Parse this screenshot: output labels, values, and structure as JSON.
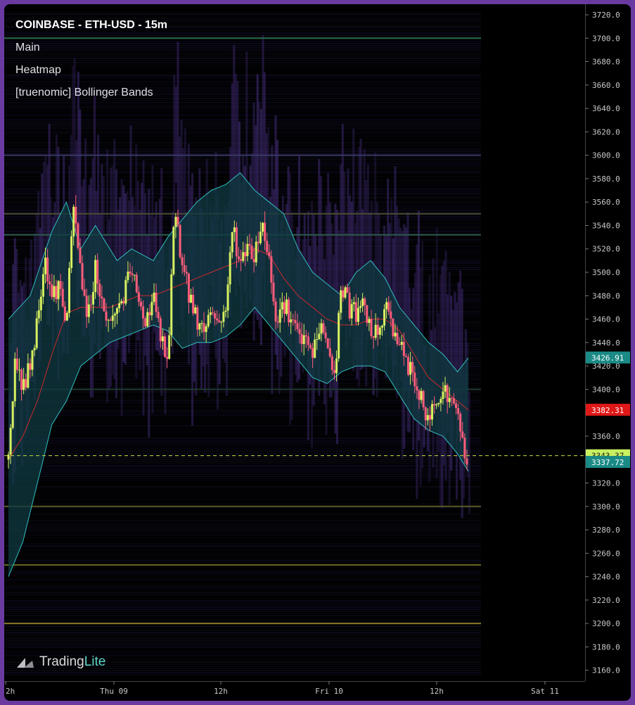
{
  "legend": {
    "title": "COINBASE - ETH-USD - 15m",
    "lines": [
      "Main",
      "Heatmap",
      "[truenomic] Bollinger Bands"
    ]
  },
  "brand": {
    "part1": "Trading",
    "part2": "Lite"
  },
  "colors": {
    "up": "#d8f060",
    "down": "#ff5c7a",
    "band_fill": "#0f3a40",
    "band_edge": "#2fbfbf",
    "basis": "#cc2a2a",
    "last_line": "#c8e040",
    "background": "#000000",
    "axis_text": "#c8c8cc"
  },
  "chart_data": {
    "type": "candlestick",
    "y_axis": {
      "range": [
        3155,
        3723
      ],
      "ticks": [
        "3720.0",
        "3700.0",
        "3680.0",
        "3660.0",
        "3640.0",
        "3620.0",
        "3600.0",
        "3580.0",
        "3560.0",
        "3540.0",
        "3520.0",
        "3500.0",
        "3480.0",
        "3460.0",
        "3440.0",
        "3420.0",
        "3400.0",
        "3380.0",
        "3360.0",
        "3340.0",
        "3320.0",
        "3300.0",
        "3280.0",
        "3260.0",
        "3240.0",
        "3220.0",
        "3200.0",
        "3180.0",
        "3160.0"
      ]
    },
    "x_axis": {
      "range_hours": [
        0,
        95
      ],
      "ticks": [
        {
          "label": "2h",
          "hour": 0
        },
        {
          "label": "Thu 09",
          "hour": 22
        },
        {
          "label": "12h",
          "hour": 34
        },
        {
          "label": "Fri 10",
          "hour": 46
        },
        {
          "label": "12h",
          "hour": 58
        },
        {
          "label": "Sat 11",
          "hour": 70
        }
      ]
    },
    "price_series": [
      [
        0,
        3340
      ],
      [
        2,
        3430
      ],
      [
        4,
        3400
      ],
      [
        6,
        3420
      ],
      [
        8,
        3460
      ],
      [
        10,
        3515
      ],
      [
        12,
        3480
      ],
      [
        14,
        3490
      ],
      [
        16,
        3455
      ],
      [
        18,
        3555
      ],
      [
        20,
        3500
      ],
      [
        22,
        3460
      ],
      [
        24,
        3505
      ],
      [
        26,
        3470
      ],
      [
        28,
        3455
      ],
      [
        30,
        3470
      ],
      [
        32,
        3480
      ],
      [
        34,
        3505
      ],
      [
        36,
        3470
      ],
      [
        38,
        3460
      ],
      [
        40,
        3480
      ],
      [
        42,
        3445
      ],
      [
        44,
        3420
      ],
      [
        46,
        3560
      ],
      [
        48,
        3505
      ],
      [
        50,
        3480
      ],
      [
        52,
        3460
      ],
      [
        54,
        3450
      ],
      [
        56,
        3470
      ],
      [
        58,
        3455
      ],
      [
        60,
        3470
      ],
      [
        62,
        3540
      ],
      [
        64,
        3505
      ],
      [
        66,
        3525
      ],
      [
        68,
        3515
      ],
      [
        70,
        3545
      ],
      [
        72,
        3510
      ],
      [
        74,
        3460
      ],
      [
        76,
        3475
      ],
      [
        78,
        3460
      ],
      [
        80,
        3445
      ],
      [
        82,
        3440
      ],
      [
        84,
        3430
      ],
      [
        86,
        3455
      ],
      [
        88,
        3440
      ],
      [
        90,
        3410
      ],
      [
        92,
        3490
      ],
      [
        94,
        3470
      ],
      [
        96,
        3465
      ],
      [
        98,
        3470
      ],
      [
        100,
        3450
      ],
      [
        102,
        3445
      ],
      [
        104,
        3470
      ],
      [
        106,
        3455
      ],
      [
        108,
        3440
      ],
      [
        110,
        3420
      ],
      [
        112,
        3410
      ],
      [
        114,
        3390
      ],
      [
        116,
        3370
      ],
      [
        118,
        3395
      ],
      [
        120,
        3400
      ],
      [
        122,
        3390
      ],
      [
        124,
        3380
      ],
      [
        126,
        3345
      ],
      [
        127,
        3337.72
      ]
    ],
    "bollinger": {
      "upper": [
        [
          0,
          3460
        ],
        [
          6,
          3480
        ],
        [
          12,
          3535
        ],
        [
          16,
          3560
        ],
        [
          20,
          3520
        ],
        [
          24,
          3540
        ],
        [
          30,
          3510
        ],
        [
          34,
          3520
        ],
        [
          40,
          3510
        ],
        [
          44,
          3530
        ],
        [
          48,
          3545
        ],
        [
          52,
          3560
        ],
        [
          56,
          3570
        ],
        [
          60,
          3575
        ],
        [
          64,
          3585
        ],
        [
          68,
          3570
        ],
        [
          72,
          3560
        ],
        [
          76,
          3550
        ],
        [
          80,
          3520
        ],
        [
          84,
          3500
        ],
        [
          88,
          3490
        ],
        [
          92,
          3480
        ],
        [
          96,
          3500
        ],
        [
          100,
          3510
        ],
        [
          104,
          3495
        ],
        [
          108,
          3470
        ],
        [
          112,
          3455
        ],
        [
          116,
          3440
        ],
        [
          120,
          3430
        ],
        [
          124,
          3415
        ],
        [
          127,
          3426.91
        ]
      ],
      "basis": [
        [
          0,
          3340
        ],
        [
          4,
          3360
        ],
        [
          8,
          3390
        ],
        [
          12,
          3430
        ],
        [
          16,
          3465
        ],
        [
          20,
          3470
        ],
        [
          24,
          3470
        ],
        [
          28,
          3470
        ],
        [
          32,
          3475
        ],
        [
          36,
          3480
        ],
        [
          40,
          3480
        ],
        [
          44,
          3485
        ],
        [
          48,
          3490
        ],
        [
          52,
          3495
        ],
        [
          56,
          3500
        ],
        [
          60,
          3505
        ],
        [
          64,
          3510
        ],
        [
          68,
          3520
        ],
        [
          72,
          3515
        ],
        [
          76,
          3495
        ],
        [
          80,
          3480
        ],
        [
          84,
          3470
        ],
        [
          88,
          3460
        ],
        [
          92,
          3455
        ],
        [
          96,
          3455
        ],
        [
          100,
          3460
        ],
        [
          104,
          3460
        ],
        [
          108,
          3450
        ],
        [
          112,
          3430
        ],
        [
          116,
          3410
        ],
        [
          120,
          3400
        ],
        [
          124,
          3390
        ],
        [
          127,
          3382.31
        ]
      ],
      "lower": [
        [
          0,
          3240
        ],
        [
          4,
          3270
        ],
        [
          8,
          3320
        ],
        [
          12,
          3370
        ],
        [
          16,
          3390
        ],
        [
          20,
          3420
        ],
        [
          24,
          3430
        ],
        [
          28,
          3440
        ],
        [
          32,
          3445
        ],
        [
          36,
          3450
        ],
        [
          40,
          3455
        ],
        [
          44,
          3450
        ],
        [
          48,
          3435
        ],
        [
          52,
          3440
        ],
        [
          56,
          3440
        ],
        [
          60,
          3445
        ],
        [
          64,
          3455
        ],
        [
          68,
          3470
        ],
        [
          72,
          3455
        ],
        [
          76,
          3440
        ],
        [
          80,
          3425
        ],
        [
          84,
          3410
        ],
        [
          88,
          3405
        ],
        [
          92,
          3415
        ],
        [
          96,
          3420
        ],
        [
          100,
          3420
        ],
        [
          104,
          3415
        ],
        [
          108,
          3395
        ],
        [
          112,
          3375
        ],
        [
          116,
          3365
        ],
        [
          120,
          3360
        ],
        [
          124,
          3345
        ],
        [
          127,
          3330
        ]
      ]
    },
    "price_labels": [
      {
        "text": "3426.91",
        "value": 3426.91,
        "color": "#1a8a86"
      },
      {
        "text": "3382.31",
        "value": 3382.31,
        "color": "#e01818"
      },
      {
        "text": "3343.37",
        "value": 3343.37,
        "color": "#c8f060"
      },
      {
        "text": "3337.72",
        "value": 3337.72,
        "color": "#1a8a86"
      }
    ],
    "last_price_line": 3343.37,
    "liquidity_levels": [
      {
        "price": 3700,
        "color": "#2a6a4a"
      },
      {
        "price": 3600,
        "color": "#3a3a6a"
      },
      {
        "price": 3550,
        "color": "#4a4a30"
      },
      {
        "price": 3532,
        "color": "#2a5a4a"
      },
      {
        "price": 3400,
        "color": "#203a30"
      },
      {
        "price": 3300,
        "color": "#5a5a28"
      },
      {
        "price": 3250,
        "color": "#6a6a20"
      },
      {
        "price": 3200,
        "color": "#8a7a20"
      }
    ]
  }
}
